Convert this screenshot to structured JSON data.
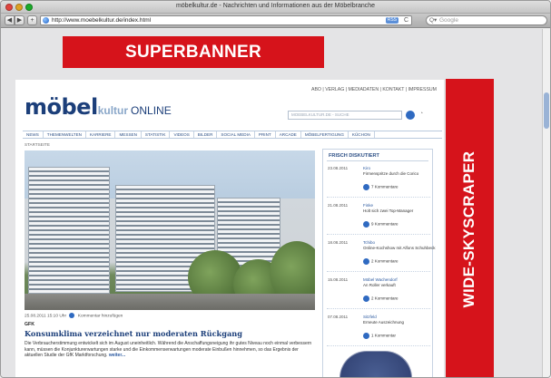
{
  "window": {
    "title": "möbelkultur.de - Nachrichten und Informationen aus der Möbelbranche"
  },
  "toolbar": {
    "back": "◀",
    "forward": "▶",
    "add": "+",
    "url": "http://www.moebelkultur.de/index.html",
    "rss": "RSS",
    "reload": "C",
    "search_placeholder": "Google"
  },
  "ads": {
    "superbanner": "SUPERBANNER",
    "skyscraper": "WIDE-SKYSCRAPER"
  },
  "site": {
    "topnav": "ABO | VERLAG | MEDIADATEN | KONTAKT | IMPRESSUM",
    "logo_main": "möbel",
    "logo_kultur": "kultur",
    "logo_online": "ONLINE",
    "search_placeholder": "MOEBELKULTUR.DE - SUCHE",
    "nav": [
      "NEWS",
      "THEMENWELTEN",
      "KARRIERE",
      "MESSEN",
      "STATISTIK",
      "VIDEOS",
      "BILDER",
      "SOCIAL MEDIA",
      "PRINT",
      "ARCADE",
      "MÖBELFERTIGUNG",
      "KÜCHON"
    ],
    "breadcrumb": "STARTSEITE"
  },
  "article": {
    "meta_date": "25.08.2011 15:10 Uhr",
    "meta_comment": "Kommentar hinzufügen",
    "kicker": "GFK",
    "headline": "Konsumklima verzeichnet nur moderaten Rückgang",
    "teaser": "Die Verbraucherstimmung entwickelt sich im August uneinheitlich. Während die Anschaffungsneigung ihr gutes Niveau noch einmal verbessern kann, müssen die Konjunkturerwartungen starke und die Einkommenserwartungen moderate Einbußen hinnehmen, so das Ergebnis der aktuellen Studie der GfK Marktforschung.",
    "more": "weiter..."
  },
  "sidebar": {
    "title": "FRISCH DISKUTIERT",
    "entries": [
      {
        "date": "23.08.2011",
        "title": "Kiro",
        "subtitle": "Firmenspritze durch die Corico",
        "comments": "7 Kommentare"
      },
      {
        "date": "21.08.2011",
        "title": "Finke",
        "subtitle": "Holt sich zwei Top-Manager",
        "comments": "9 Kommentare"
      },
      {
        "date": "18.08.2011",
        "title": "Tchibo",
        "subtitle": "Online-Kochshow mit Alfons Schuhbeck",
        "comments": "2 Kommentare"
      },
      {
        "date": "15.08.2011",
        "title": "Möbel Wachendorf",
        "subtitle": "An Roller verkauft",
        "comments": "2 Kommentare"
      },
      {
        "date": "07.08.2011",
        "title": "Sitzfeld",
        "subtitle": "Erneute Auszeichnung",
        "comments": "1 Kommentar"
      }
    ]
  },
  "colors": {
    "ad_red": "#d6131b",
    "brand_blue": "#1c3f7a",
    "link_blue": "#2c5aa0"
  }
}
